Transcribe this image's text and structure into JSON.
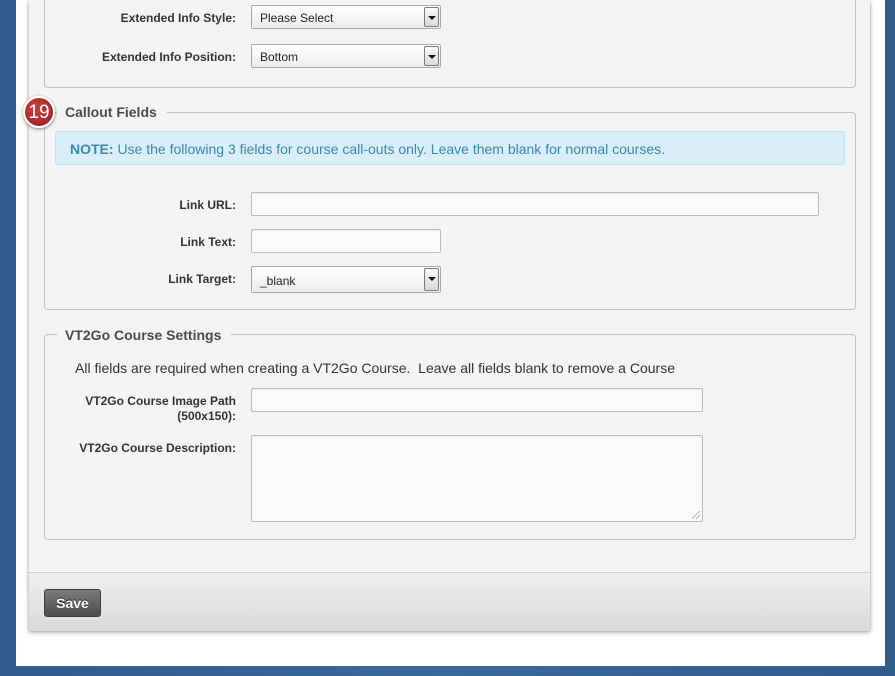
{
  "extended_info": {
    "style_label": "Extended Info Style:",
    "style_value": "Please Select",
    "position_label": "Extended Info Position:",
    "position_value": "Bottom"
  },
  "callout": {
    "step_badge": "19",
    "legend": "Callout Fields",
    "note_prefix": "NOTE:",
    "note_text": " Use the following 3 fields for course call-outs only. Leave them blank for normal courses.",
    "link_url_label": "Link URL:",
    "link_url_value": "",
    "link_text_label": "Link Text:",
    "link_text_value": "",
    "link_target_label": "Link Target:",
    "link_target_value": "_blank"
  },
  "vt2go": {
    "legend": "VT2Go Course Settings",
    "info": "All fields are required when creating a VT2Go Course.  Leave all fields blank to remove a Course",
    "image_path_label_line1": "VT2Go Course Image Path",
    "image_path_label_line2": "(500x150):",
    "image_path_value": "",
    "description_label": "VT2Go Course Description:",
    "description_value": ""
  },
  "footer": {
    "save_label": "Save"
  },
  "colors": {
    "badge": "#b22e2e",
    "note_bg": "#d9eef7",
    "note_text": "#3a87ad"
  }
}
